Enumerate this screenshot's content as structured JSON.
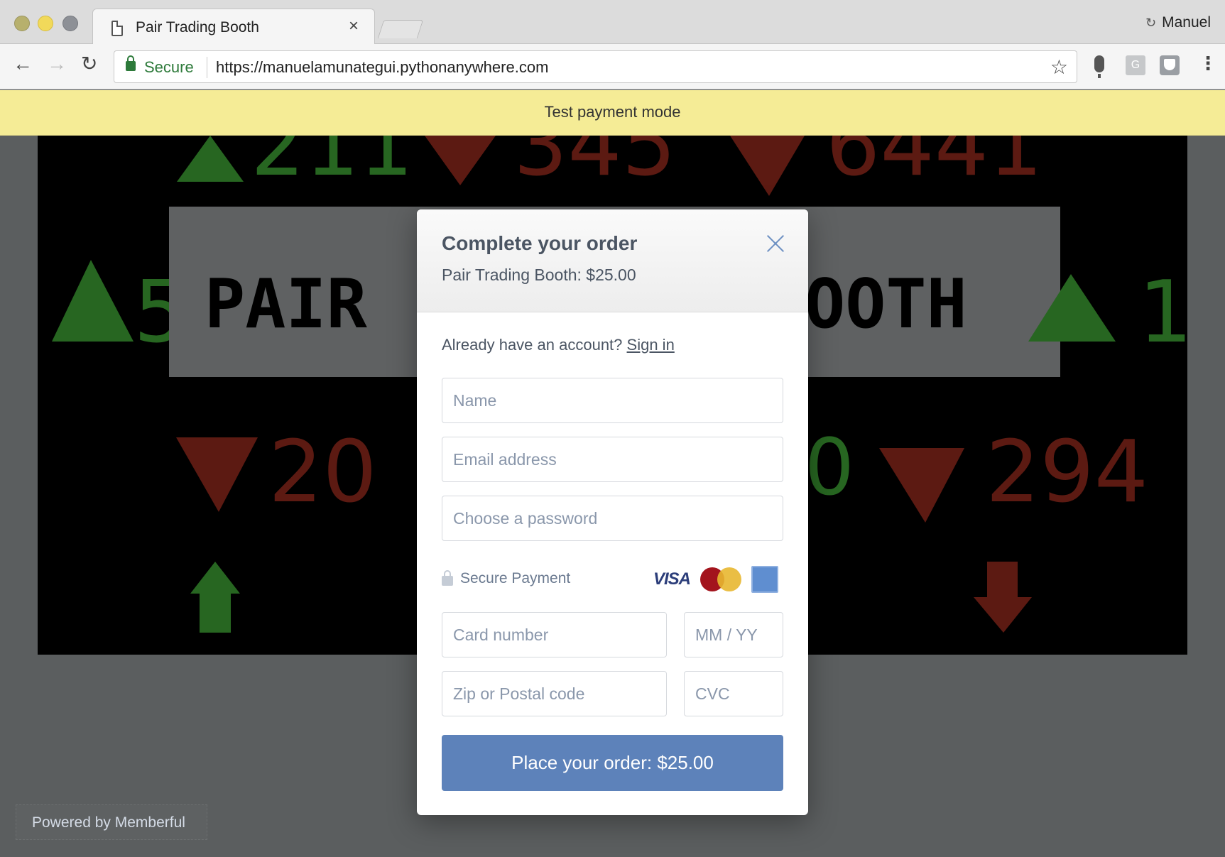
{
  "browser": {
    "tab_title": "Pair Trading Booth",
    "tab_close": "×",
    "profile_name": "Manuel",
    "secure_label": "Secure",
    "url": "https://manuelamunategui.pythonanywhere.com",
    "menu_glyph": "⋮",
    "back_glyph": "←",
    "forward_glyph": "→",
    "reload_glyph": "↻",
    "star_glyph": "☆"
  },
  "banner": {
    "text": "Test payment mode"
  },
  "hero": {
    "title_left": "PAIR",
    "title_right": "OOTH",
    "numbers": [
      "211",
      "345",
      "6441",
      "5",
      "1",
      "20",
      "0",
      "294"
    ]
  },
  "modal": {
    "title": "Complete your order",
    "subtitle": "Pair Trading Booth: $25.00",
    "account_prompt": "Already have an account?",
    "signin_label": "Sign in",
    "fields": {
      "name_placeholder": "Name",
      "email_placeholder": "Email address",
      "password_placeholder": "Choose a password",
      "card_placeholder": "Card number",
      "expiry_placeholder": "MM / YY",
      "zip_placeholder": "Zip or Postal code",
      "cvc_placeholder": "CVC"
    },
    "secure_payment_label": "Secure Payment",
    "card_brands": [
      "VISA",
      "MasterCard",
      "American Express"
    ],
    "submit_label": "Place your order: $25.00"
  },
  "footer": {
    "powered_by": "Powered by Memberful"
  },
  "colors": {
    "banner_bg": "#f5ec96",
    "accent_button": "#5d82ba",
    "secure_green": "#2d7a3a",
    "overlay_bg": "#5b5e5f"
  }
}
